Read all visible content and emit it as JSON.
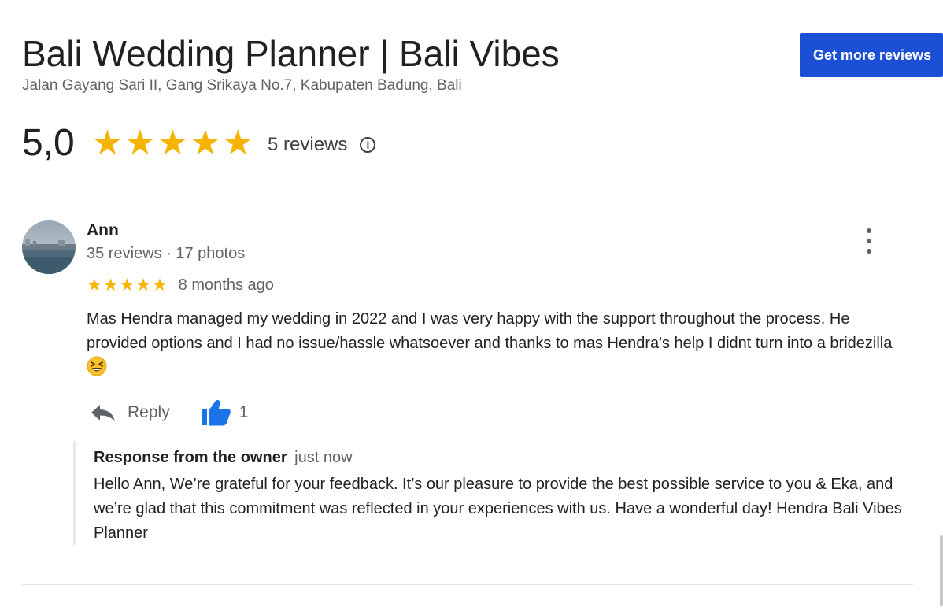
{
  "business": {
    "name": "Bali Wedding Planner | Bali Vibes",
    "address": "Jalan Gayang Sari II, Gang Srikaya No.7, Kabupaten Badung, Bali"
  },
  "cta": {
    "label": "Get more reviews"
  },
  "summary": {
    "rating": "5,0",
    "stars": 5,
    "reviews_label": "5 reviews",
    "info_icon": "info-icon"
  },
  "review": {
    "author": "Ann",
    "meta": "35 reviews · 17 photos",
    "stars": 5,
    "date": "8 months ago",
    "text": "Mas Hendra managed my wedding in 2022 and I was very happy with the support throughout the process. He provided options  and I had no issue/hassle whatsoever and thanks to mas Hendra's help I didnt turn into a bridezilla",
    "emoji": "grinning-squinting-face-emoji",
    "reply_label": "Reply",
    "like_count": "1"
  },
  "owner_response": {
    "label": "Response from the owner",
    "time": "just now",
    "text": "Hello Ann, We’re grateful for your feedback. It’s our pleasure to provide the best possible service to you & Eka, and we’re glad that this commitment was reflected in your experiences with us. Have a wonderful day! Hendra Bali Vibes Planner"
  },
  "colors": {
    "accent": "#1a4fd6",
    "star": "#f4b400",
    "like": "#1a73e8"
  }
}
